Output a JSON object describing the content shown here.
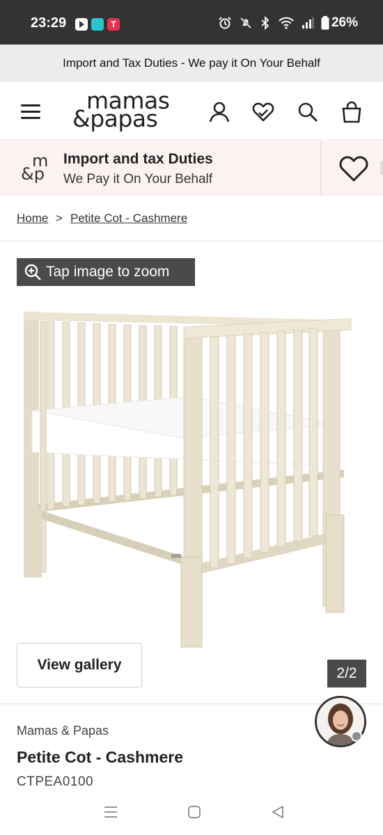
{
  "status_bar": {
    "time": "23:29",
    "battery": "26%",
    "icons": [
      "alarm-icon",
      "mute-icon",
      "bluetooth-icon",
      "wifi-icon",
      "signal-icon",
      "battery-icon"
    ],
    "app_icons": [
      "youtube-icon",
      "telegram-icon",
      "telemundo-icon"
    ],
    "app_t_letter": "T"
  },
  "promo_bar": {
    "text": "Import and Tax Duties - We pay it On Your Behalf"
  },
  "header": {
    "logo_line1": "mamas",
    "logo_line2": "&papas",
    "icons": [
      "menu-icon",
      "account-icon",
      "wishlist-icon",
      "search-icon",
      "bag-icon"
    ]
  },
  "duties_banner": {
    "logo_line1": "m",
    "logo_line2": "&p",
    "title": "Import and tax Duties",
    "subtitle": "We Pay it On Your Behalf"
  },
  "breadcrumb": {
    "home": "Home",
    "separator": ">",
    "current": "Petite Cot - Cashmere"
  },
  "gallery": {
    "zoom_label": "Tap image to zoom",
    "view_gallery_label": "View gallery",
    "counter": "2/2"
  },
  "product": {
    "brand": "Mamas & Papas",
    "title": "Petite Cot - Cashmere",
    "sku": "CTPEA0100"
  },
  "colors": {
    "status_bar_bg": "#333333",
    "promo_bg": "#ececec",
    "duties_bg": "#fdf2f2",
    "badge_bg": "#4a4a4a",
    "cot_wood": "#e8e0cc"
  }
}
